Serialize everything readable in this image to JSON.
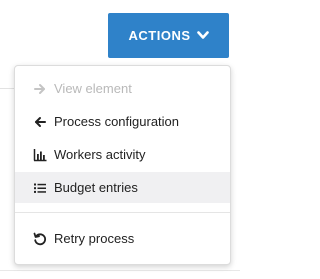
{
  "actions_button": {
    "label": "ACTIONS",
    "color": "#2f82c9",
    "icon": "chevron-down-icon"
  },
  "menu": {
    "items": [
      {
        "label": "View element",
        "icon": "arrow-right-icon",
        "disabled": true
      },
      {
        "label": "Process configuration",
        "icon": "arrow-left-icon",
        "disabled": false
      },
      {
        "label": "Workers activity",
        "icon": "bar-chart-icon",
        "disabled": false
      },
      {
        "label": "Budget entries",
        "icon": "list-icon",
        "disabled": false,
        "highlighted": true
      },
      {
        "label": "Retry process",
        "icon": "retry-icon",
        "disabled": false
      }
    ]
  }
}
